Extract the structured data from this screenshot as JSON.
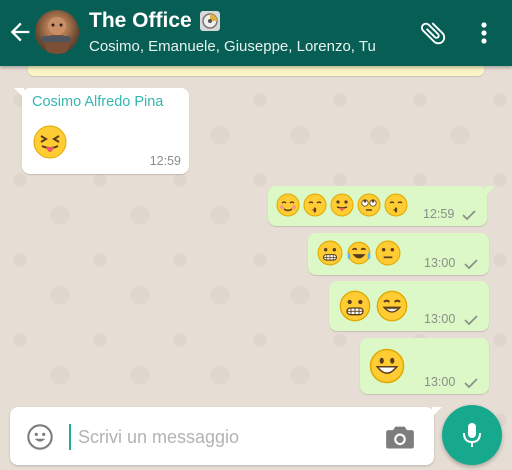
{
  "header": {
    "title": "The Office",
    "subtitle": "Cosimo, Emanuele, Giuseppe, Lorenzo, Tu",
    "back_icon": "back-arrow-icon",
    "clip_icon": "paperclip-icon",
    "more_icon": "more-vertical-icon",
    "accent": "#075e54"
  },
  "messages": [
    {
      "direction": "in",
      "sender": "Cosimo Alfredo Pina",
      "emojis": [
        "tongue-squint"
      ],
      "time": "12:59"
    },
    {
      "direction": "out",
      "emojis": [
        "relieved",
        "kissing-closed",
        "tongue",
        "rolling-eyes",
        "kissing-closed"
      ],
      "time": "12:59",
      "status": "sent"
    },
    {
      "direction": "out",
      "emojis": [
        "grimace",
        "tears-of-joy",
        "neutral"
      ],
      "time": "13:00",
      "status": "sent"
    },
    {
      "direction": "out",
      "emojis": [
        "grimace",
        "grin"
      ],
      "time": "13:00",
      "status": "sent"
    },
    {
      "direction": "out",
      "emojis": [
        "grin-big"
      ],
      "time": "13:00",
      "status": "sent"
    }
  ],
  "composer": {
    "placeholder": "Scrivi un messaggio",
    "emoji_icon": "smiley-icon",
    "camera_icon": "camera-icon",
    "mic_icon": "microphone-icon"
  },
  "colors": {
    "bubble_in": "#ffffff",
    "bubble_out": "#dcf8c6",
    "sender_name": "#35b7b0",
    "fab": "#17a98e"
  }
}
